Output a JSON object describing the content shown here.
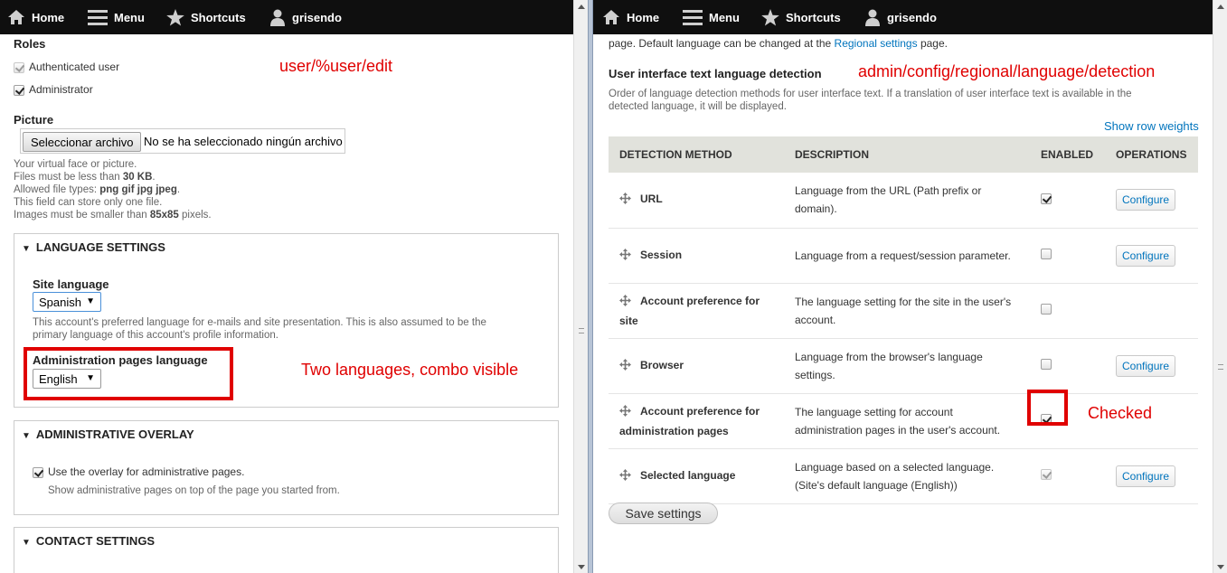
{
  "toolbar": {
    "home": "Home",
    "menu": "Menu",
    "shortcuts": "Shortcuts",
    "user": "grisendo"
  },
  "left": {
    "roles_label": "Roles",
    "roles": [
      {
        "label": "Authenticated user",
        "checked": true,
        "disabled": true
      },
      {
        "label": "Administrator",
        "checked": true,
        "disabled": false
      }
    ],
    "picture_label": "Picture",
    "file_button": "Seleccionar archivo",
    "file_status": "No se ha seleccionado ningún archivo",
    "picture_help": {
      "line1": "Your virtual face or picture.",
      "line2_prefix": "Files must be less than ",
      "line2_bold": "30 KB",
      "line2_suffix": ".",
      "line3_prefix": "Allowed file types: ",
      "line3_bold": "png gif jpg jpeg",
      "line3_suffix": ".",
      "line4": "This field can store only one file.",
      "line5_prefix": "Images must be smaller than ",
      "line5_bold": "85x85",
      "line5_suffix": " pixels."
    },
    "language_settings": {
      "legend": "LANGUAGE SETTINGS",
      "site_language_label": "Site language",
      "site_language_value": "Spanish",
      "site_language_help_1": "This account's preferred language for e-mails and site presentation. This is also assumed to be the",
      "site_language_help_2": "primary language of this account's profile information.",
      "admin_language_label": "Administration pages language",
      "admin_language_value": "English"
    },
    "overlay": {
      "legend": "ADMINISTRATIVE OVERLAY",
      "checkbox_label": "Use the overlay for administrative pages.",
      "checked": true,
      "help": "Show administrative pages on top of the page you started from."
    },
    "contact": {
      "legend": "CONTACT SETTINGS"
    },
    "annotation_path": "user/%user/edit",
    "annotation_note": "Two languages, combo visible"
  },
  "right": {
    "intro_prefix": "page. Default language can be changed at the ",
    "intro_link": "Regional settings",
    "intro_suffix": " page.",
    "section_title": "User interface text language detection",
    "section_desc_1": "Order of language detection methods for user interface text. If a translation of user interface text is available in the",
    "section_desc_2": "detected language, it will be displayed.",
    "row_weights_link": "Show row weights",
    "columns": [
      "DETECTION METHOD",
      "DESCRIPTION",
      "ENABLED",
      "OPERATIONS"
    ],
    "rows": [
      {
        "method_1": "URL",
        "method_2": "",
        "desc_1": "Language from the URL (Path prefix or",
        "desc_2": "domain).",
        "enabled": true,
        "disabled": false,
        "operation": "Configure"
      },
      {
        "method_1": "Session",
        "method_2": "",
        "desc_1": "Language from a request/session parameter.",
        "desc_2": "",
        "enabled": false,
        "disabled": false,
        "operation": "Configure"
      },
      {
        "method_1": "Account preference for",
        "method_2": "site",
        "desc_1": "The language setting for the site in the user's",
        "desc_2": "account.",
        "enabled": false,
        "disabled": false,
        "operation": ""
      },
      {
        "method_1": "Browser",
        "method_2": "",
        "desc_1": "Language from the browser's language",
        "desc_2": "settings.",
        "enabled": false,
        "disabled": false,
        "operation": "Configure"
      },
      {
        "method_1": "Account preference for",
        "method_2": "administration pages",
        "desc_1": "The language setting for account",
        "desc_2": "administration pages in the user's account.",
        "enabled": true,
        "disabled": false,
        "operation": ""
      },
      {
        "method_1": "Selected language",
        "method_2": "",
        "desc_1": "Language based on a selected language.",
        "desc_2": "(Site's default language (English))",
        "enabled": true,
        "disabled": true,
        "operation": "Configure"
      }
    ],
    "save_button": "Save settings",
    "annotation_path": "admin/config/regional/language/detection",
    "annotation_checked": "Checked"
  },
  "colors": {
    "toolbar_bg": "#0f0f0f",
    "link": "#0074bd",
    "annotation": "#e00000",
    "table_header_bg": "#e1e2dc",
    "divider": "#b7c4d6"
  }
}
